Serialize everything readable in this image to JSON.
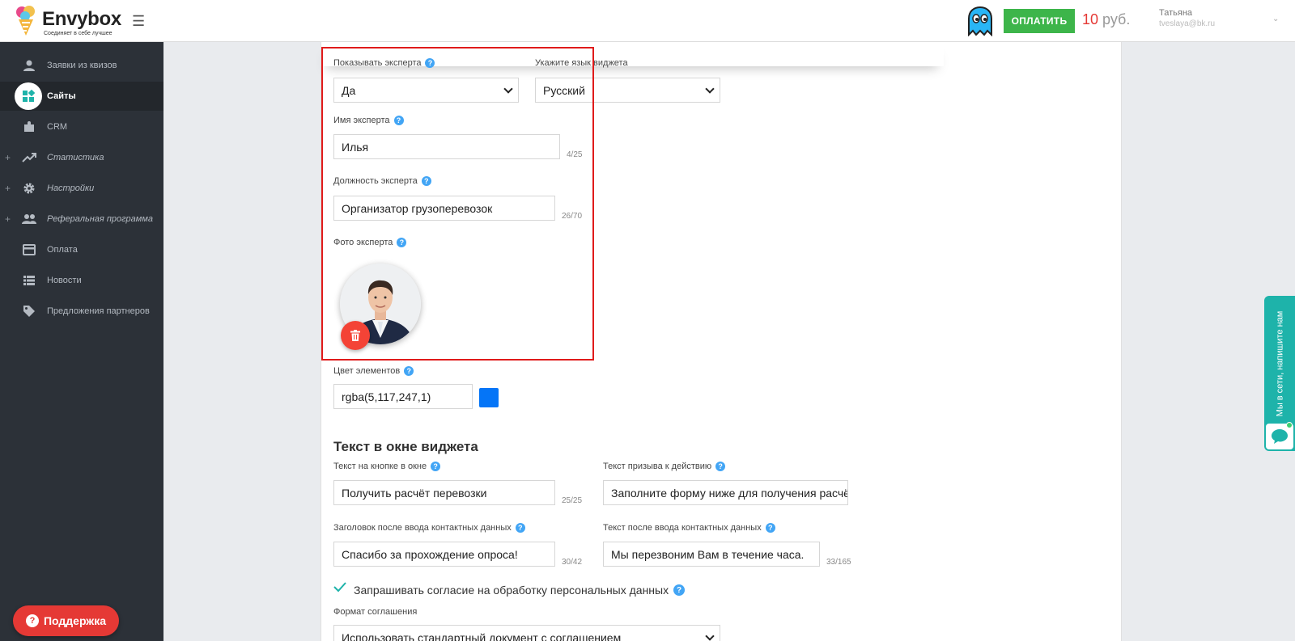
{
  "header": {
    "logo_name": "Envybox",
    "logo_tagline": "Соединяет в себе лучшее",
    "pay_button": "ОПЛАТИТЬ",
    "balance_amount": "10",
    "balance_currency": "руб.",
    "user_name": "Татьяна",
    "user_email": "tveslaya@bk.ru"
  },
  "sidebar": {
    "items": [
      {
        "label": "Заявки из квизов",
        "icon": "person-icon",
        "has_plus": false,
        "active": false
      },
      {
        "label": "Сайты",
        "icon": "widgets-icon",
        "has_plus": false,
        "active": true
      },
      {
        "label": "CRM",
        "icon": "puzzle-icon",
        "has_plus": false,
        "active": false
      },
      {
        "label": "Статистика",
        "icon": "trending-icon",
        "has_plus": true,
        "active": false
      },
      {
        "label": "Настройки",
        "icon": "gear-icon",
        "has_plus": true,
        "active": false
      },
      {
        "label": "Реферальная программа",
        "icon": "people-icon",
        "has_plus": true,
        "active": false
      },
      {
        "label": "Оплата",
        "icon": "card-icon",
        "has_plus": false,
        "active": false
      },
      {
        "label": "Новости",
        "icon": "list-icon",
        "has_plus": false,
        "active": false
      },
      {
        "label": "Предложения партнеров",
        "icon": "tag-icon",
        "has_plus": false,
        "active": false
      }
    ],
    "plus_symbol": "+",
    "support_button": "Поддержка"
  },
  "form": {
    "show_expert_label": "Показывать эксперта",
    "show_expert_value": "Да",
    "language_label": "Укажите язык виджета",
    "language_value": "Русский",
    "expert_name_label": "Имя эксперта",
    "expert_name_value": "Илья",
    "expert_name_counter": "4/25",
    "expert_position_label": "Должность эксперта",
    "expert_position_value": "Организатор грузоперевозок",
    "expert_position_counter": "26/70",
    "expert_photo_label": "Фото эксперта",
    "color_label": "Цвет элементов",
    "color_value": "rgba(5,117,247,1)",
    "color_hex": "#0575f7",
    "section_title": "Текст в окне виджета",
    "button_text_label": "Текст на кнопке в окне",
    "button_text_value": "Получить расчёт перевозки",
    "button_text_counter": "25/25",
    "cta_label": "Текст призыва к действию",
    "cta_value": "Заполните форму ниже для получения расчё",
    "after_contact_title_label": "Заголовок после ввода контактных данных",
    "after_contact_title_value": "Спасибо за прохождение опроса!",
    "after_contact_title_counter": "30/42",
    "after_contact_text_label": "Текст после ввода контактных данных",
    "after_contact_text_value": "Мы перезвоним Вам в течение часа.",
    "after_contact_text_counter": "33/165",
    "consent_label": "Запрашивать согласие на обработку персональных данных",
    "consent_checked": true,
    "agreement_format_label": "Формат соглашения",
    "agreement_format_value": "Использовать стандартный документ с соглашением",
    "help_glyph": "?"
  },
  "chat_widget": {
    "text": "Мы в сети, напишите нам"
  },
  "colors": {
    "accent_green": "#3db54a",
    "accent_red": "#e53935",
    "sidebar_bg": "#2c3138",
    "chat_teal": "#1eb3aa",
    "highlight_border": "#e01b1b"
  }
}
